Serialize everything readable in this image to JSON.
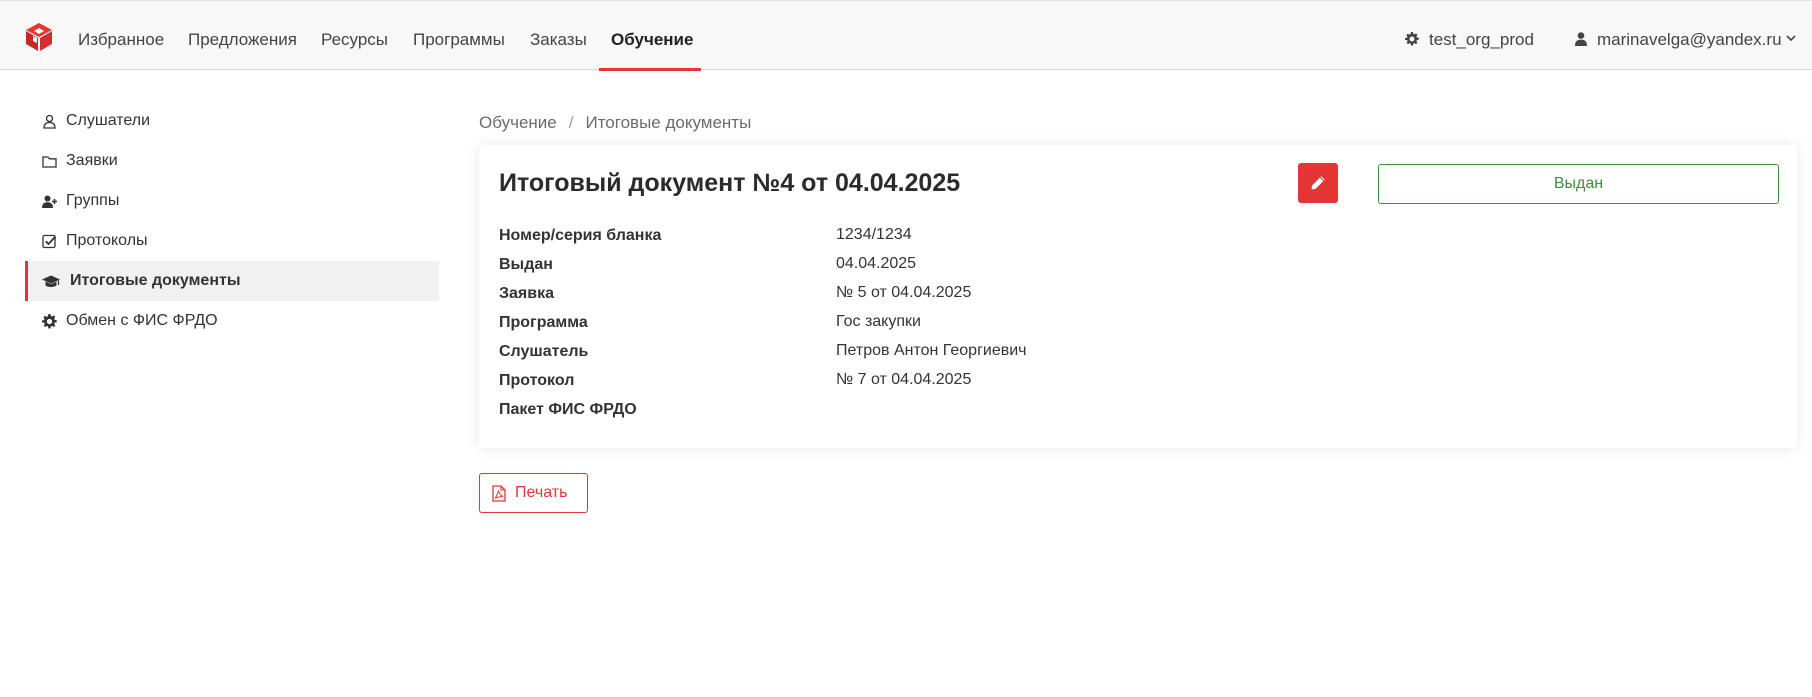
{
  "nav": {
    "items": [
      {
        "label": "Избранное"
      },
      {
        "label": "Предложения"
      },
      {
        "label": "Ресурсы"
      },
      {
        "label": "Программы"
      },
      {
        "label": "Заказы"
      },
      {
        "label": "Обучение",
        "active": true
      }
    ],
    "org": "test_org_prod",
    "user": "marinavelga@yandex.ru"
  },
  "sidebar": {
    "items": [
      {
        "label": "Слушатели",
        "icon": "user-icon"
      },
      {
        "label": "Заявки",
        "icon": "folder-icon"
      },
      {
        "label": "Группы",
        "icon": "user-plus-icon"
      },
      {
        "label": "Протоколы",
        "icon": "check-square-icon"
      },
      {
        "label": "Итоговые документы",
        "icon": "graduation-cap-icon",
        "active": true
      },
      {
        "label": "Обмен с ФИС ФРДО",
        "icon": "gear-icon"
      }
    ]
  },
  "breadcrumb": {
    "items": [
      "Обучение",
      "Итоговые документы"
    ],
    "separator": "/"
  },
  "document": {
    "title": "Итоговый документ №4 от 04.04.2025",
    "status": "Выдан",
    "fields": [
      {
        "label": "Номер/серия бланка",
        "value": "1234/1234"
      },
      {
        "label": "Выдан",
        "value": "04.04.2025"
      },
      {
        "label": "Заявка",
        "value": "№ 5 от 04.04.2025"
      },
      {
        "label": "Программа",
        "value": "Гос закупки"
      },
      {
        "label": "Слушатель",
        "value": "Петров Антон Георгиевич"
      },
      {
        "label": "Протокол",
        "value": "№ 7 от 04.04.2025"
      },
      {
        "label": "Пакет ФИС ФРДО",
        "value": ""
      }
    ]
  },
  "actions": {
    "print_label": "Печать"
  },
  "colors": {
    "accent": "#e53535",
    "success": "#3e8e41",
    "navbar_bg": "#f8f8f8"
  }
}
